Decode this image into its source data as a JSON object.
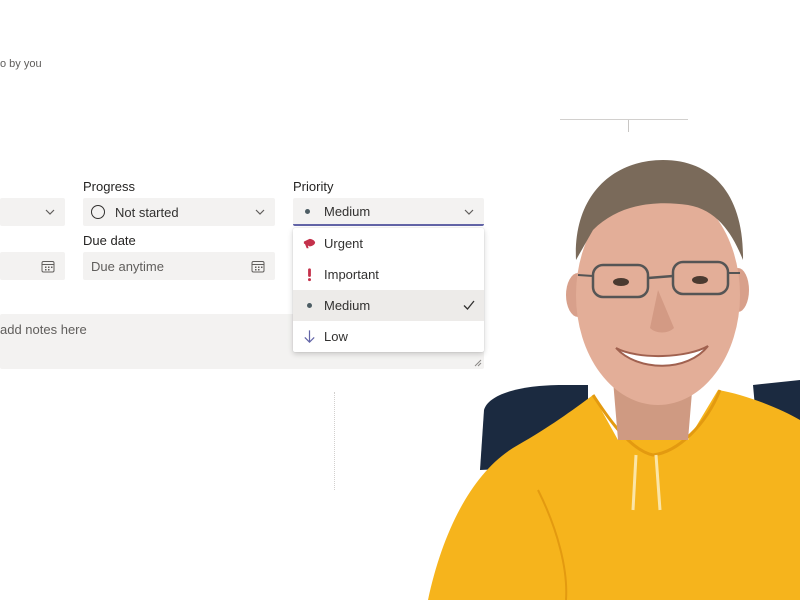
{
  "breadcrumb_text": "o by you",
  "progress": {
    "label": "Progress",
    "value": "Not started"
  },
  "priority": {
    "label": "Priority",
    "value": "Medium",
    "options": [
      {
        "label": "Urgent",
        "icon": "urgent-megaphone-icon",
        "color": "#c4314b"
      },
      {
        "label": "Important",
        "icon": "exclamation-icon",
        "color": "#c4314b"
      },
      {
        "label": "Medium",
        "icon": "dot-icon",
        "color": "#4d5d64",
        "selected": true
      },
      {
        "label": "Low",
        "icon": "arrow-down-icon",
        "color": "#6264a7"
      }
    ]
  },
  "due_date": {
    "label": "Due date",
    "placeholder": "Due anytime"
  },
  "notes": {
    "placeholder": "add notes here"
  },
  "colors": {
    "field_bg": "#f3f2f1",
    "accent_underline": "#6264a7",
    "hoodie": "#f6b41c"
  }
}
